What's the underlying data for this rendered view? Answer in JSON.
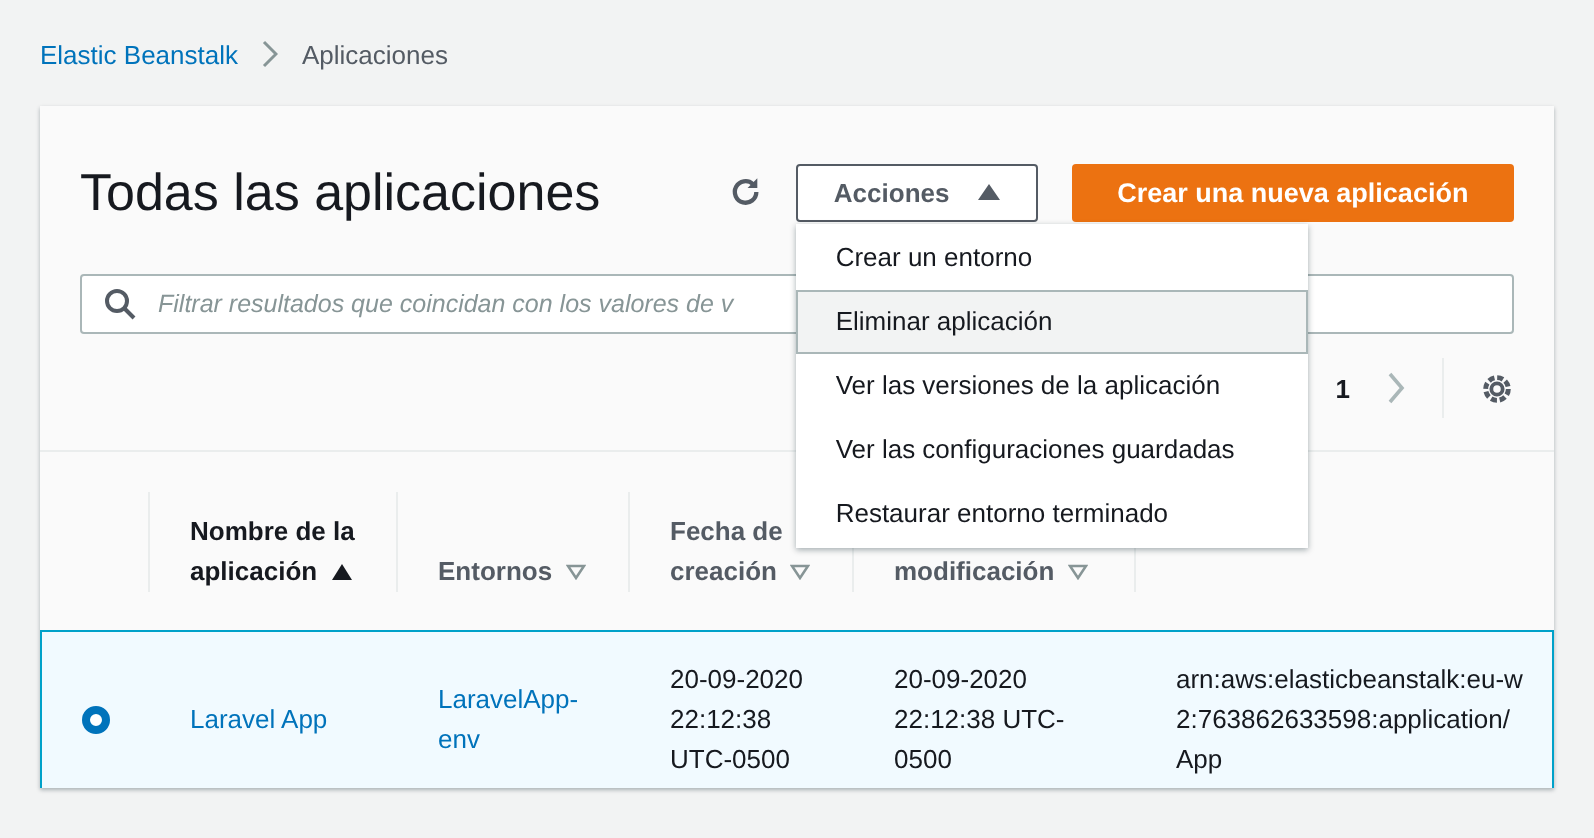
{
  "breadcrumb": [
    {
      "label": "Elastic Beanstalk"
    },
    {
      "label": "Aplicaciones"
    }
  ],
  "header": {
    "title": "Todas las aplicaciones",
    "actions_button": "Acciones",
    "create_button": "Crear una nueva aplicación"
  },
  "actions_menu": {
    "expanded": true,
    "items": [
      {
        "label": "Crear un entorno",
        "highlighted": false
      },
      {
        "label": "Eliminar aplicación",
        "highlighted": true
      },
      {
        "label": "Ver las versiones de la aplicación",
        "highlighted": false
      },
      {
        "label": "Ver las configuraciones guardadas",
        "highlighted": false
      },
      {
        "label": "Restaurar entorno terminado",
        "highlighted": false
      }
    ]
  },
  "search": {
    "placeholder": "Filtrar resultados que coincidan con los valores de v"
  },
  "pagination": {
    "page": "1"
  },
  "table": {
    "columns": [
      {
        "label": "Nombre de la aplicación",
        "sorted": true
      },
      {
        "label": "Entornos",
        "sorted": false
      },
      {
        "label": "Fecha de creación",
        "sorted": false
      },
      {
        "label": "modificación",
        "sorted": false
      }
    ],
    "rows": [
      {
        "selected": true,
        "cells": [
          {
            "text": "Laravel App",
            "link": true
          },
          {
            "text": "LaravelApp-env",
            "link": true
          },
          {
            "text": "20-09-2020 22:12:38 UTC-0500",
            "link": false
          },
          {
            "text": "20-09-2020 22:12:38 UTC-0500",
            "link": false
          },
          {
            "text": "arn:aws:elasticbeanstalk:eu-w\n2:763862633598:application/\nApp",
            "link": false
          }
        ]
      }
    ]
  }
}
